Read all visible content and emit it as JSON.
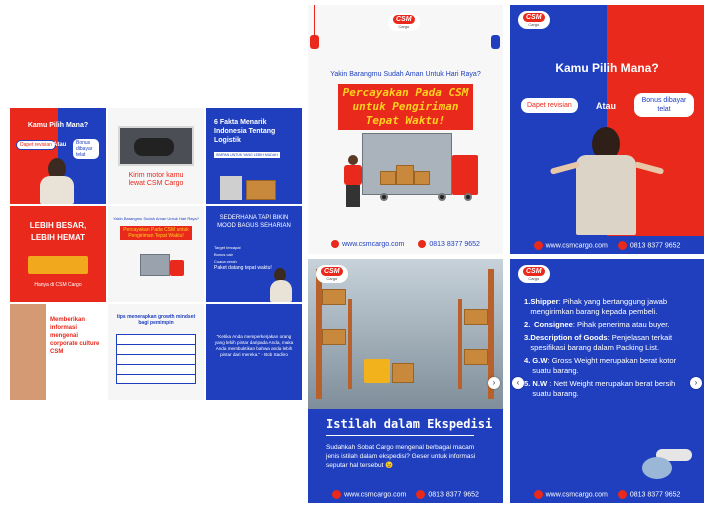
{
  "grid": {
    "t1": {
      "title": "Kamu Pilih Mana?",
      "left_bubble": "Dapet revisian",
      "mid": "Atau",
      "right_bubble": "Bonus dibayar telat"
    },
    "t2": {
      "caption_top": "Kirim motor kamu lewat CSM Cargo",
      "caption": "Kirim motor kamu lewat CSM Cargo"
    },
    "t3": {
      "title": "6 Fakta Menarik Indonesia Tentang Logistik",
      "tag": "SIMPAN UNTUK YANG LEBIH MUDAH"
    },
    "t4": {
      "title": "LEBIH BESAR, LEBIH HEMAT",
      "caption": "Hanya di CSM Cargo"
    },
    "t5": {
      "top": "Yakin Barangmu Sudah Aman Untuk Hari Raya?",
      "headline": "Percayakan Pada CSM untuk Pengiriman Tepat Waktu!"
    },
    "t6": {
      "title": "SEDERHANA TAPI BIKIN MOOD BAGUS SEHARIAN",
      "items": [
        "Target tercapai",
        "Bonus cair",
        "Cuaca cerah",
        "Paket datang tepat waktu!"
      ]
    },
    "t7": {
      "title": "Memberikan informasi mengenai corporate culture CSM"
    },
    "t8": {
      "title": "tips menerapkan growth mindset bagi pemimpin"
    },
    "t9": {
      "quote": "\"Ketika Anda memperkerjakan orang yang lebih pintar daripada Anda, maka Anda membuktikan bahwa anda lebih pintar dari mereka.\" - Bob Sadino"
    }
  },
  "panel_raya": {
    "question": "Yakin Barangmu Sudah Aman Untuk Hari Raya?",
    "headline": "Percayakan Pada CSM untuk Pengiriman Tepat Waktu!",
    "website": "www.csmcargo.com",
    "phone": "0813 8377 9652",
    "logo": "CSM",
    "logo_sub": "Cargo"
  },
  "panel_pilih": {
    "title": "Kamu Pilih Mana?",
    "left_bubble": "Dapet revisian",
    "mid": "Atau",
    "right_bubble": "Bonus dibayar telat",
    "website": "www.csmcargo.com",
    "phone": "0813 8377 9652",
    "logo": "CSM",
    "logo_sub": "Cargo"
  },
  "panel_istilah": {
    "title": "Istilah dalam Ekspedisi",
    "body": "Sudahkah Sobat Cargo mengenal berbagai macam jenis istilah dalam ekspedisi? Geser untuk informasi seputar hal tersebut 😉",
    "website": "www.csmcargo.com",
    "phone": "0813 8377 9652",
    "logo": "CSM",
    "logo_sub": "Cargo"
  },
  "panel_terms": {
    "items": [
      {
        "n": "1.",
        "term": "Shipper",
        "def": ": Pihak yang bertanggung jawab mengirimkan barang kepada pembeli."
      },
      {
        "n": "2.",
        "term": "Consignee",
        "def": ": Pihak penerima atau buyer."
      },
      {
        "n": "3.",
        "term": "Description of Goods",
        "def": ": Penjelasan terkait spesifikasi barang dalam Packing List."
      },
      {
        "n": "4.",
        "term": "G.W",
        "def": ": Gross Weight merupakan berat kotor suatu barang."
      },
      {
        "n": "5.",
        "term": "N.W",
        "def": " : Nett Weight merupakan berat bersih suatu barang."
      }
    ],
    "website": "www.csmcargo.com",
    "phone": "0813 8377 9652",
    "logo": "CSM",
    "logo_sub": "Cargo"
  },
  "colors": {
    "red": "#e8291c",
    "blue": "#1f3fbf",
    "yellow": "#ffd21e"
  }
}
